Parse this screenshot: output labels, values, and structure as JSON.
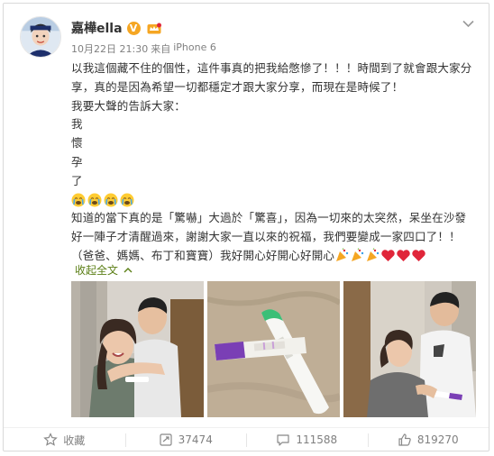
{
  "header": {
    "username": "嘉樺ella",
    "verified_mark": "V",
    "timestamp": "10月22日 21:30",
    "source_prefix": "来自",
    "device": "iPhone 6"
  },
  "post": {
    "lines": [
      "以我這個藏不住的個性，這件事真的把我給憋慘了！！！時間到了就會跟大家分",
      "享，真的是因為希望一切都穩定才跟大家分享，而現在是時候了！",
      "我要大聲的告訴大家：",
      "我",
      "懷",
      "孕",
      "了"
    ],
    "lines_after_emoji": [
      "知道的當下真的是「驚嚇」大過於「驚喜」，因為一切來的太突然，呆坐在沙發",
      "好一陣子才清醒過來，謝謝大家一直以來的祝福，我們要變成一家四口了！！"
    ],
    "last_line": "（爸爸、媽媽、布丁和寶寶）我好開心好開心好開心",
    "cry_emoji_count": 4,
    "party_emoji_count": 3,
    "heart_emoji_count": 3
  },
  "collapse": {
    "label": "收起全文"
  },
  "photos": [
    {
      "icon": "couple-photo"
    },
    {
      "icon": "pregnancy-test-photo"
    },
    {
      "icon": "couple-test-photo"
    }
  ],
  "toolbar": {
    "favorite_label": "收藏",
    "repost_count": "37474",
    "comment_count": "111588",
    "like_count": "819270"
  },
  "colors": {
    "link_green": "#5a7e14",
    "badge_orange": "#f5a623",
    "heart_red": "#e0263a",
    "muted": "#808080"
  }
}
